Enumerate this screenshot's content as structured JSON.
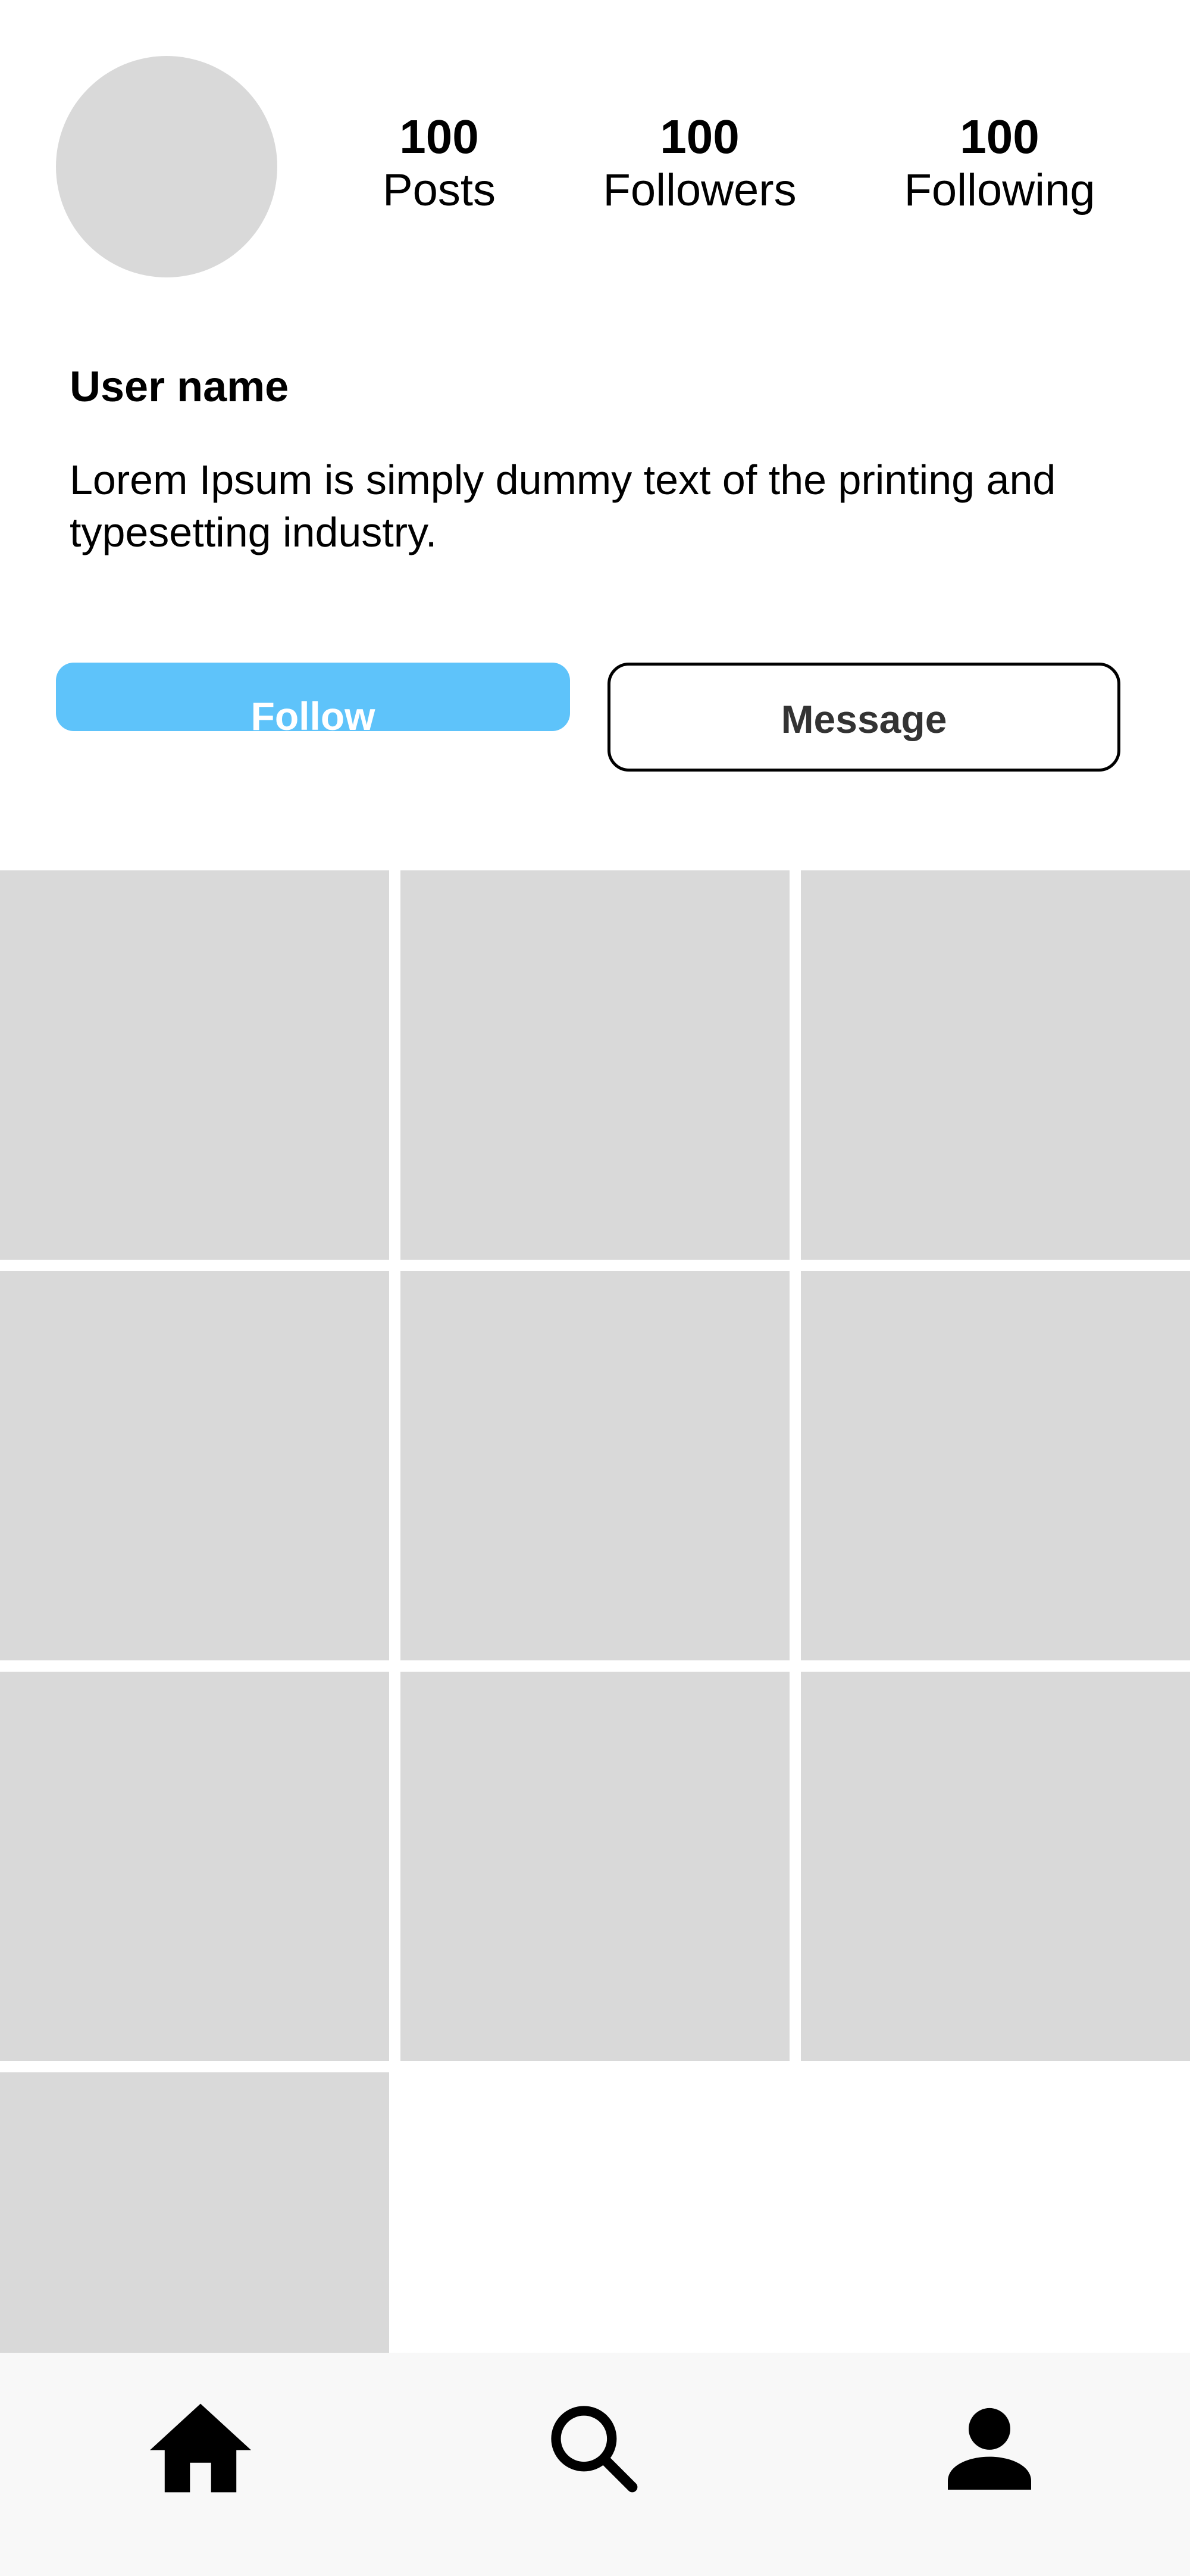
{
  "profile": {
    "stats": [
      {
        "value": "100",
        "label": "Posts"
      },
      {
        "value": "100",
        "label": "Followers"
      },
      {
        "value": "100",
        "label": "Following"
      }
    ],
    "username": "User name",
    "bio": "Lorem Ipsum is simply dummy text of the printing and typesetting industry."
  },
  "actions": {
    "follow_label": "Follow",
    "message_label": "Message"
  },
  "grid": {
    "tile_count": 10
  },
  "bottom_nav": {
    "items": [
      {
        "icon": "home-icon"
      },
      {
        "icon": "search-icon"
      },
      {
        "icon": "person-icon"
      }
    ]
  },
  "colors": {
    "accent": "#5ec3fa",
    "placeholder": "#d9d9d9",
    "nav_background": "#f8f8f8"
  }
}
